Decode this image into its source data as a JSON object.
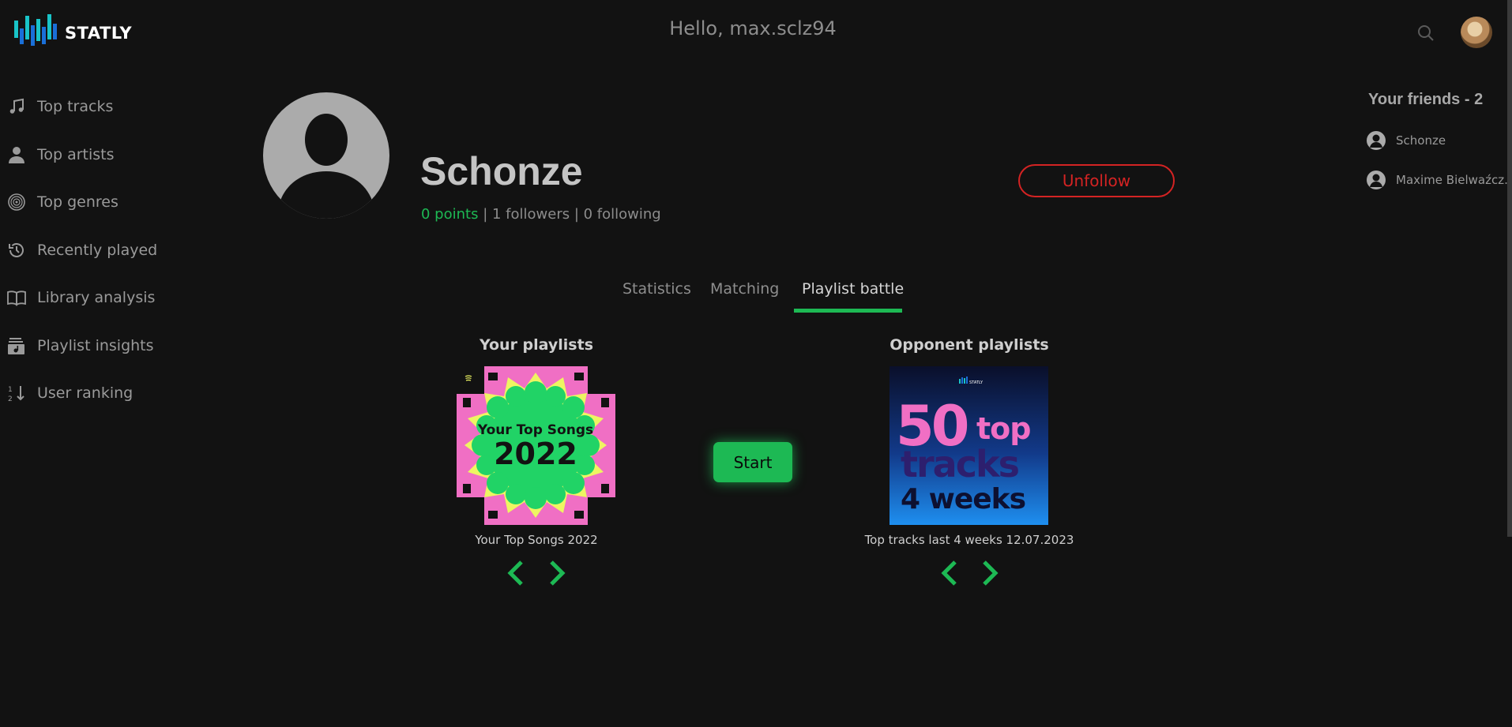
{
  "app": {
    "logo_text": "STATLY"
  },
  "header": {
    "greeting": "Hello, max.sclz94"
  },
  "sidebar": {
    "items": [
      {
        "label": "Top tracks",
        "icon": "music-note-icon"
      },
      {
        "label": "Top artists",
        "icon": "person-icon"
      },
      {
        "label": "Top genres",
        "icon": "vinyl-icon"
      },
      {
        "label": "Recently played",
        "icon": "history-icon"
      },
      {
        "label": "Library analysis",
        "icon": "book-icon"
      },
      {
        "label": "Playlist insights",
        "icon": "playlist-icon"
      },
      {
        "label": "User ranking",
        "icon": "sort-numeric-icon"
      }
    ]
  },
  "profile": {
    "name": "Schonze",
    "points": "0 points",
    "sep1": " | ",
    "followers": "1 followers",
    "sep2": " | ",
    "following": "0 following",
    "unfollow_label": "Unfollow"
  },
  "friends": {
    "title": "Your friends - 2",
    "list": [
      {
        "name": "Schonze"
      },
      {
        "name": "Maxime Bielwaźcz..."
      }
    ]
  },
  "tabs": [
    {
      "label": "Statistics",
      "active": false
    },
    {
      "label": "Matching",
      "active": false
    },
    {
      "label": "Playlist battle",
      "active": true
    }
  ],
  "battle": {
    "your_title": "Your playlists",
    "your_playlist": {
      "name": "Your Top Songs 2022",
      "cover_line1": "Your Top Songs",
      "cover_line2": "2022"
    },
    "opponent_title": "Opponent playlists",
    "opponent_playlist": {
      "name": "Top tracks last 4 weeks 12.07.2023",
      "cover_num": "50",
      "cover_word1": "top",
      "cover_word2": "tracks",
      "cover_word3": "4 weeks",
      "cover_brand": "STATLY"
    },
    "start_label": "Start"
  },
  "colors": {
    "accent": "#1db954",
    "danger": "#d42323",
    "background": "#121212"
  }
}
